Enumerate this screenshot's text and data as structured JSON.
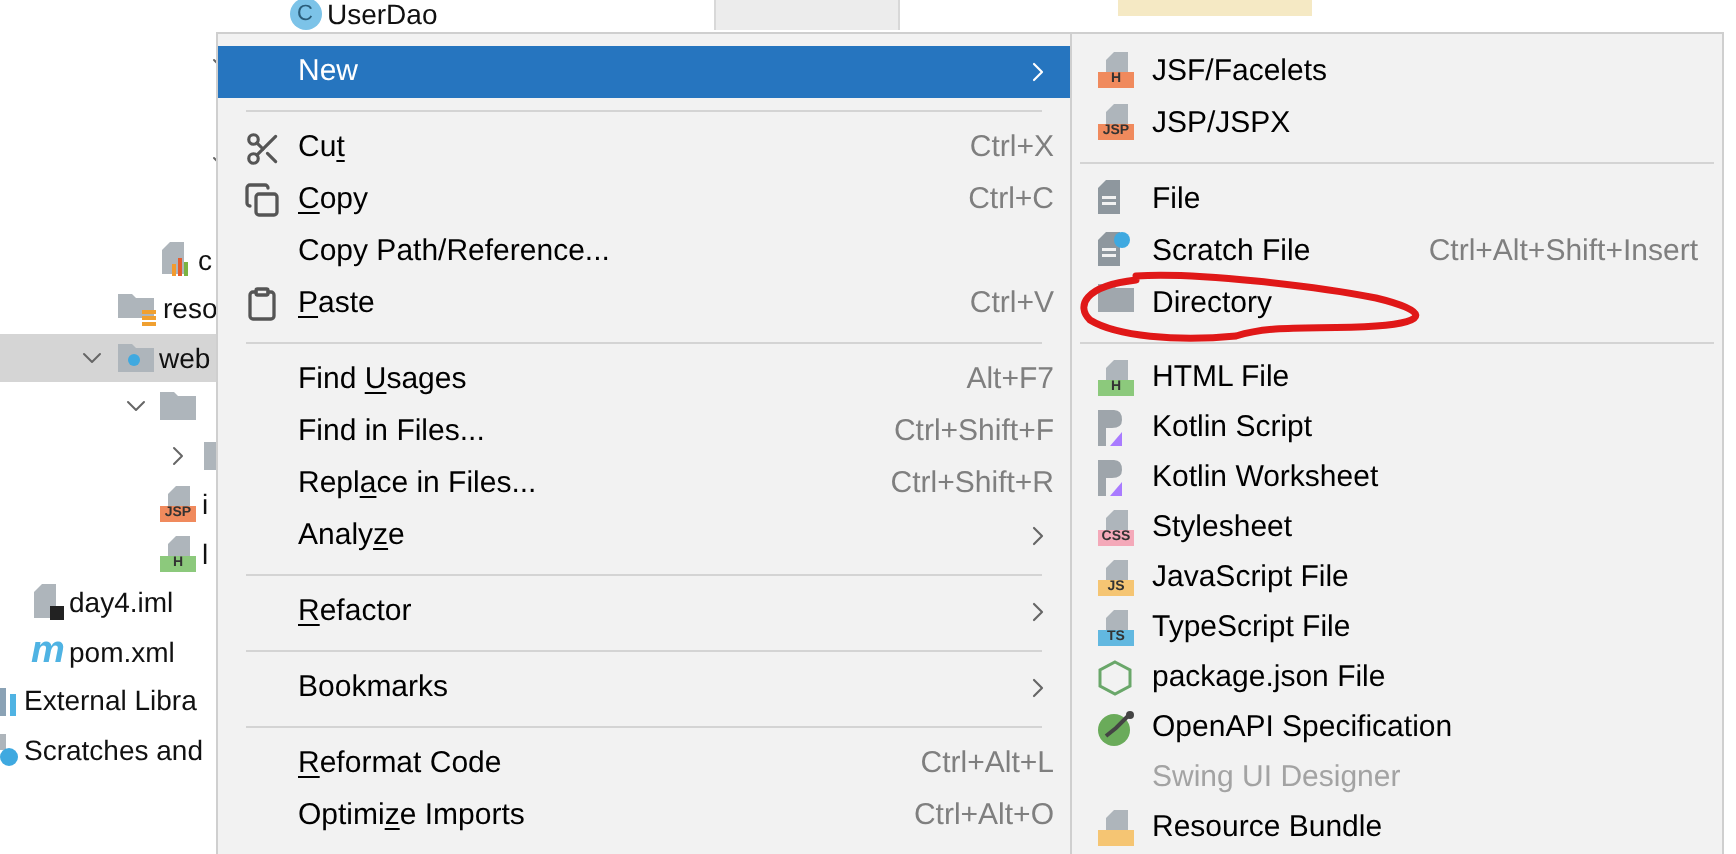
{
  "project_tree": [
    {
      "children": [
        {
          "children": [
            {
              "children": [
                {
                  "children": [
                    {
                      "children": [
                        {
                          "children": [
                            {
                              "children": [
                                {
                                  "label": "UserDao",
                                  "kind": "class",
                                  "badge": "C"
                                }
                              ]
                            },
                            {
                              "expanded": true,
                              "children": [
                                {
                                  "kind": "covered"
                                }
                              ]
                            },
                            {
                              "expanded": true,
                              "children": [
                                {
                                  "kind": "covered"
                                }
                              ]
                            }
                          ]
                        }
                      ]
                    },
                    {
                      "label": "c",
                      "kind": "chart-file"
                    }
                  ]
                },
                {
                  "label": "reso",
                  "kind": "resources-folder"
                },
                {
                  "label": "web",
                  "kind": "web-folder",
                  "expanded": true,
                  "selected": true,
                  "children": [
                    {
                      "kind": "folder",
                      "expanded": true,
                      "children": [
                        {
                          "kind": "folder",
                          "expanded": false
                        }
                      ]
                    },
                    {
                      "label": "i",
                      "kind": "badge-file",
                      "badge": "JSP",
                      "color": "#f08a5d"
                    },
                    {
                      "label": "l",
                      "kind": "badge-file",
                      "badge": "H",
                      "color": "#8cc97c"
                    }
                  ]
                }
              ]
            }
          ]
        },
        {
          "label": "day4.iml",
          "kind": "module-file"
        },
        {
          "label": "pom.xml",
          "kind": "maven",
          "badge": "m"
        }
      ]
    },
    {
      "label": "External Libra",
      "kind": "libraries"
    },
    {
      "label": "Scratches and",
      "kind": "scratches"
    }
  ],
  "context_menu": [
    {
      "kind": "plain",
      "label": "New",
      "submenu": true,
      "selected": true
    },
    {
      "kind": "separator"
    },
    {
      "kind": "scissors",
      "label_before": "Cu",
      "mnemonic": "t",
      "shortcut": "Ctrl+X",
      "selected": false
    },
    {
      "kind": "copy",
      "mnemonic": "C",
      "label_after": "opy",
      "shortcut": "Ctrl+C",
      "selected": false
    },
    {
      "kind": "plain",
      "label": "Copy Path/Reference...",
      "selected": false
    },
    {
      "kind": "paste",
      "mnemonic": "P",
      "label_after": "aste",
      "shortcut": "Ctrl+V",
      "selected": false
    },
    {
      "kind": "separator"
    },
    {
      "kind": "plain",
      "label_before": "Find ",
      "mnemonic": "U",
      "label_after": "sages",
      "shortcut": "Alt+F7",
      "selected": false
    },
    {
      "kind": "plain",
      "label": "Find in Files...",
      "shortcut": "Ctrl+Shift+F",
      "selected": false
    },
    {
      "kind": "plain",
      "label_before": "Repl",
      "mnemonic": "a",
      "label_after": "ce in Files...",
      "shortcut": "Ctrl+Shift+R",
      "selected": false
    },
    {
      "kind": "plain",
      "label_before": "Analy",
      "mnemonic": "z",
      "label_after": "e",
      "submenu": true,
      "selected": false
    },
    {
      "kind": "separator"
    },
    {
      "kind": "plain",
      "mnemonic": "R",
      "label_after": "efactor",
      "submenu": true,
      "selected": false
    },
    {
      "kind": "separator"
    },
    {
      "kind": "plain",
      "label": "Bookmarks",
      "submenu": true,
      "selected": false
    },
    {
      "kind": "separator"
    },
    {
      "kind": "plain",
      "mnemonic": "R",
      "label_after": "eformat Code",
      "shortcut": "Ctrl+Alt+L",
      "selected": false
    },
    {
      "kind": "plain",
      "label_before": "Optimi",
      "mnemonic": "z",
      "label_after": "e Imports",
      "shortcut": "Ctrl+Alt+O",
      "selected": false
    }
  ],
  "new_submenu": [
    {
      "kind": "badge-file",
      "label": "JSF/Facelets",
      "badge": "H",
      "color": "#f08a5d",
      "disabled": false
    },
    {
      "kind": "badge-file",
      "label": "JSP/JSPX",
      "badge": "JSP",
      "color": "#f08a5d",
      "disabled": false
    },
    {
      "kind": "separator"
    },
    {
      "kind": "file",
      "label": "File",
      "disabled": false
    },
    {
      "kind": "scratch",
      "label": "Scratch File",
      "shortcut": "Ctrl+Alt+Shift+Insert",
      "disabled": false
    },
    {
      "kind": "folder",
      "label": "Directory",
      "disabled": false
    },
    {
      "kind": "separator"
    },
    {
      "kind": "badge-file",
      "label": "HTML File",
      "badge": "H",
      "color": "#8cc97c",
      "disabled": false
    },
    {
      "kind": "kotlin",
      "label": "Kotlin Script",
      "disabled": false
    },
    {
      "kind": "kotlin",
      "label": "Kotlin Worksheet",
      "disabled": false
    },
    {
      "kind": "badge-file",
      "label": "Stylesheet",
      "badge": "CSS",
      "color": "#f4a9b9",
      "disabled": false
    },
    {
      "kind": "badge-file",
      "label": "JavaScript File",
      "badge": "JS",
      "color": "#f5c573",
      "disabled": false
    },
    {
      "kind": "badge-file",
      "label": "TypeScript File",
      "badge": "TS",
      "color": "#62b8e0",
      "disabled": false
    },
    {
      "kind": "node",
      "label": "package.json File",
      "disabled": false
    },
    {
      "kind": "openapi",
      "label": "OpenAPI Specification",
      "disabled": false
    },
    {
      "kind": "plain",
      "label": "Swing UI Designer",
      "disabled": true
    },
    {
      "kind": "badge-file",
      "label": "Resource Bundle",
      "color": "#f5c573",
      "disabled": false
    }
  ],
  "annotation": {
    "kind": "ellipse"
  }
}
